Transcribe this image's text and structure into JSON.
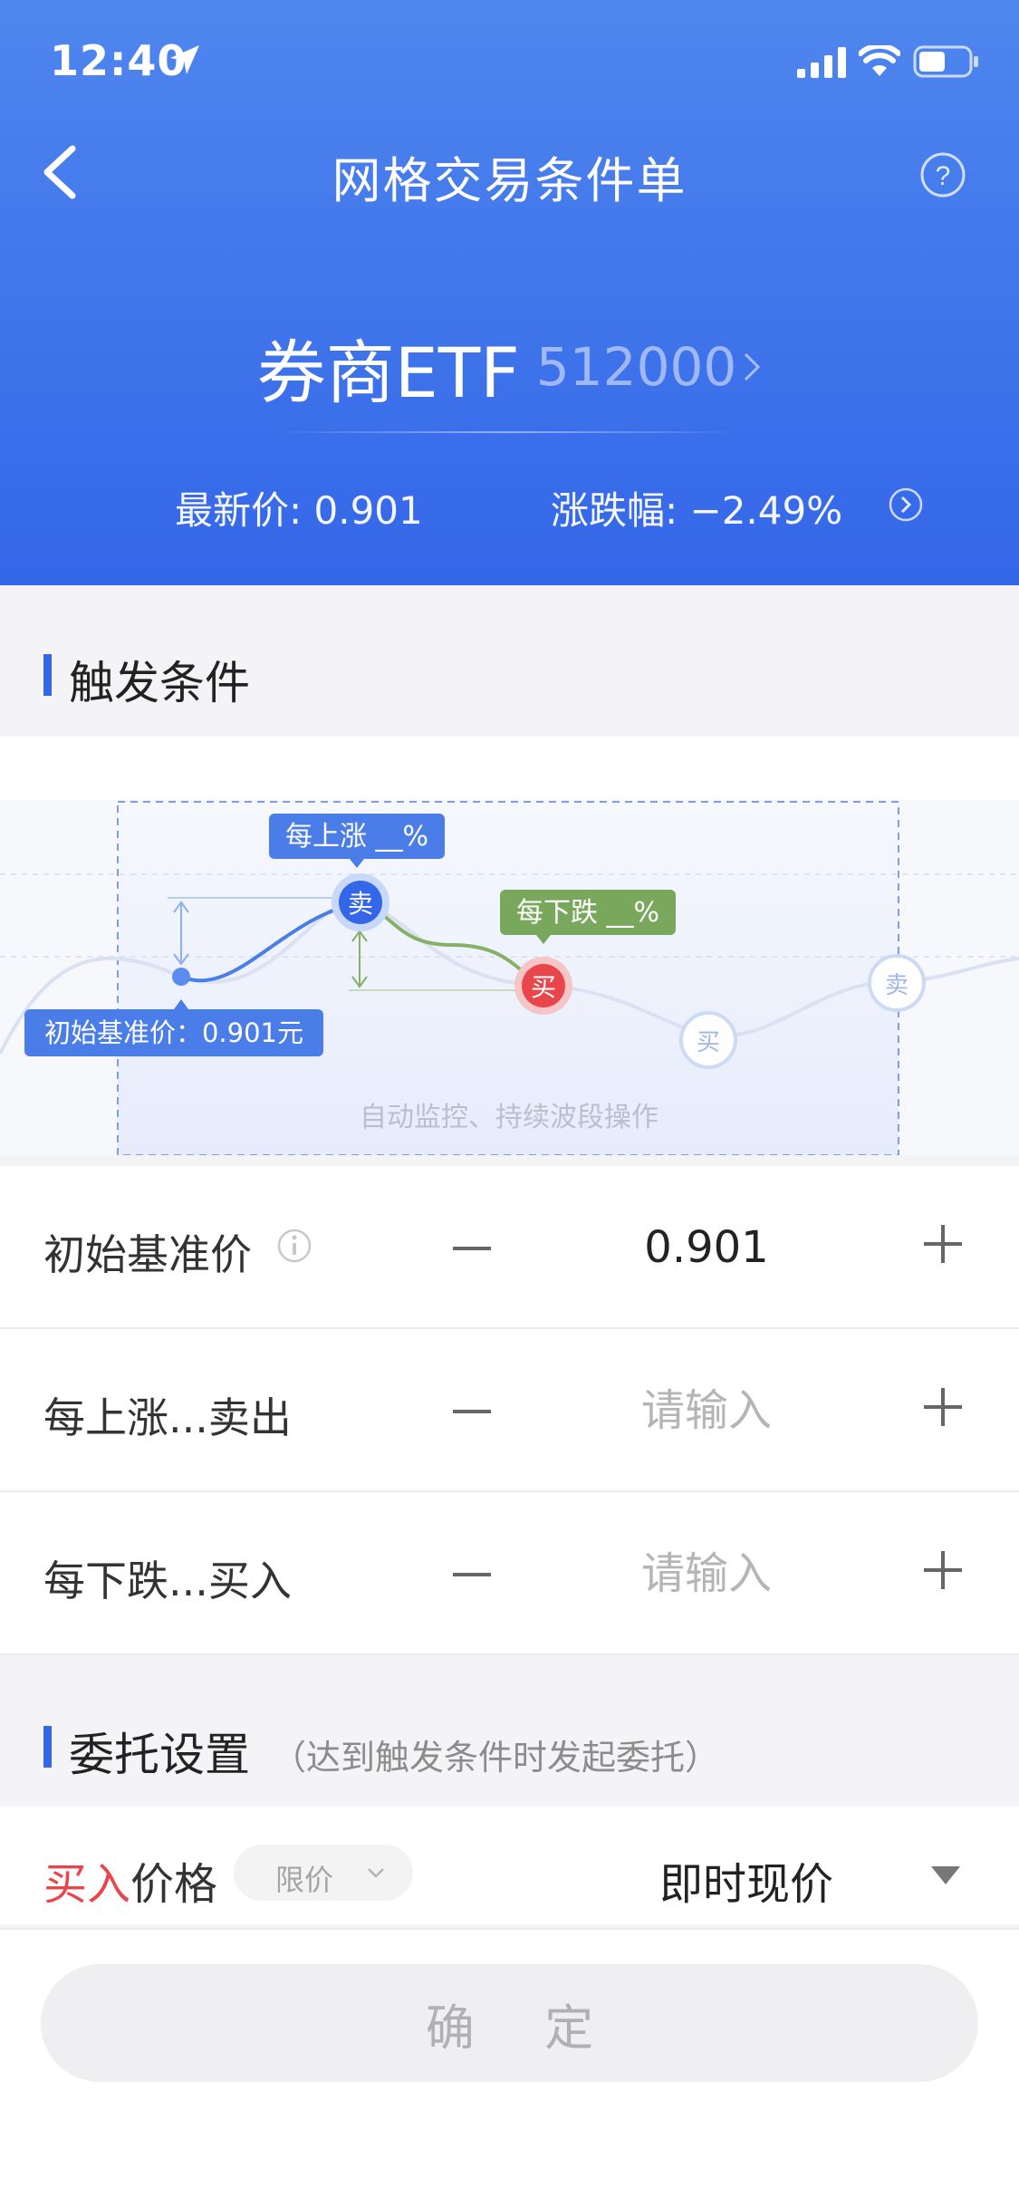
{
  "status_bar": {
    "time": "12:40"
  },
  "nav": {
    "title": "网格交易条件单"
  },
  "stock": {
    "name": "券商ETF",
    "code": "512000"
  },
  "quote": {
    "price": "最新价: 0.901",
    "change": "涨跌幅: −2.49%"
  },
  "trigger_section": {
    "title": "触发条件"
  },
  "chart": {
    "rise_tag": "每上涨 __%",
    "fall_tag": "每下跌 __%",
    "base_tag": "初始基准价：0.901元",
    "sell_marker": "卖",
    "buy_marker": "买",
    "caption": "自动监控、持续波段操作"
  },
  "rows": [
    {
      "label": "初始基准价",
      "value": "0.901",
      "placeholder": ""
    },
    {
      "label": "每上涨...卖出",
      "value": "",
      "placeholder": "请输入"
    },
    {
      "label": "每下跌...买入",
      "value": "",
      "placeholder": "请输入"
    }
  ],
  "order_section": {
    "title": "委托设置",
    "note": "（达到触发条件时发起委托）"
  },
  "buy_row": {
    "label_highlight": "买入",
    "label_rest": "价格",
    "type": "限价",
    "price": "即时现价"
  },
  "confirm": {
    "label": "确 定"
  },
  "colors": {
    "header_top": "#4f86ee",
    "header_bottom": "#3466e8",
    "sell_blue": "#3466e8",
    "buy_red": "#e8464a",
    "fall_green": "#79a85c"
  },
  "icons": [
    "location-arrow-icon",
    "signal-icon",
    "wifi-icon",
    "battery-icon",
    "back-icon",
    "help-icon",
    "chevron-right-icon",
    "circle-arrow-icon",
    "info-icon",
    "minus-icon",
    "plus-icon",
    "chevron-down-icon",
    "caret-down-icon"
  ]
}
